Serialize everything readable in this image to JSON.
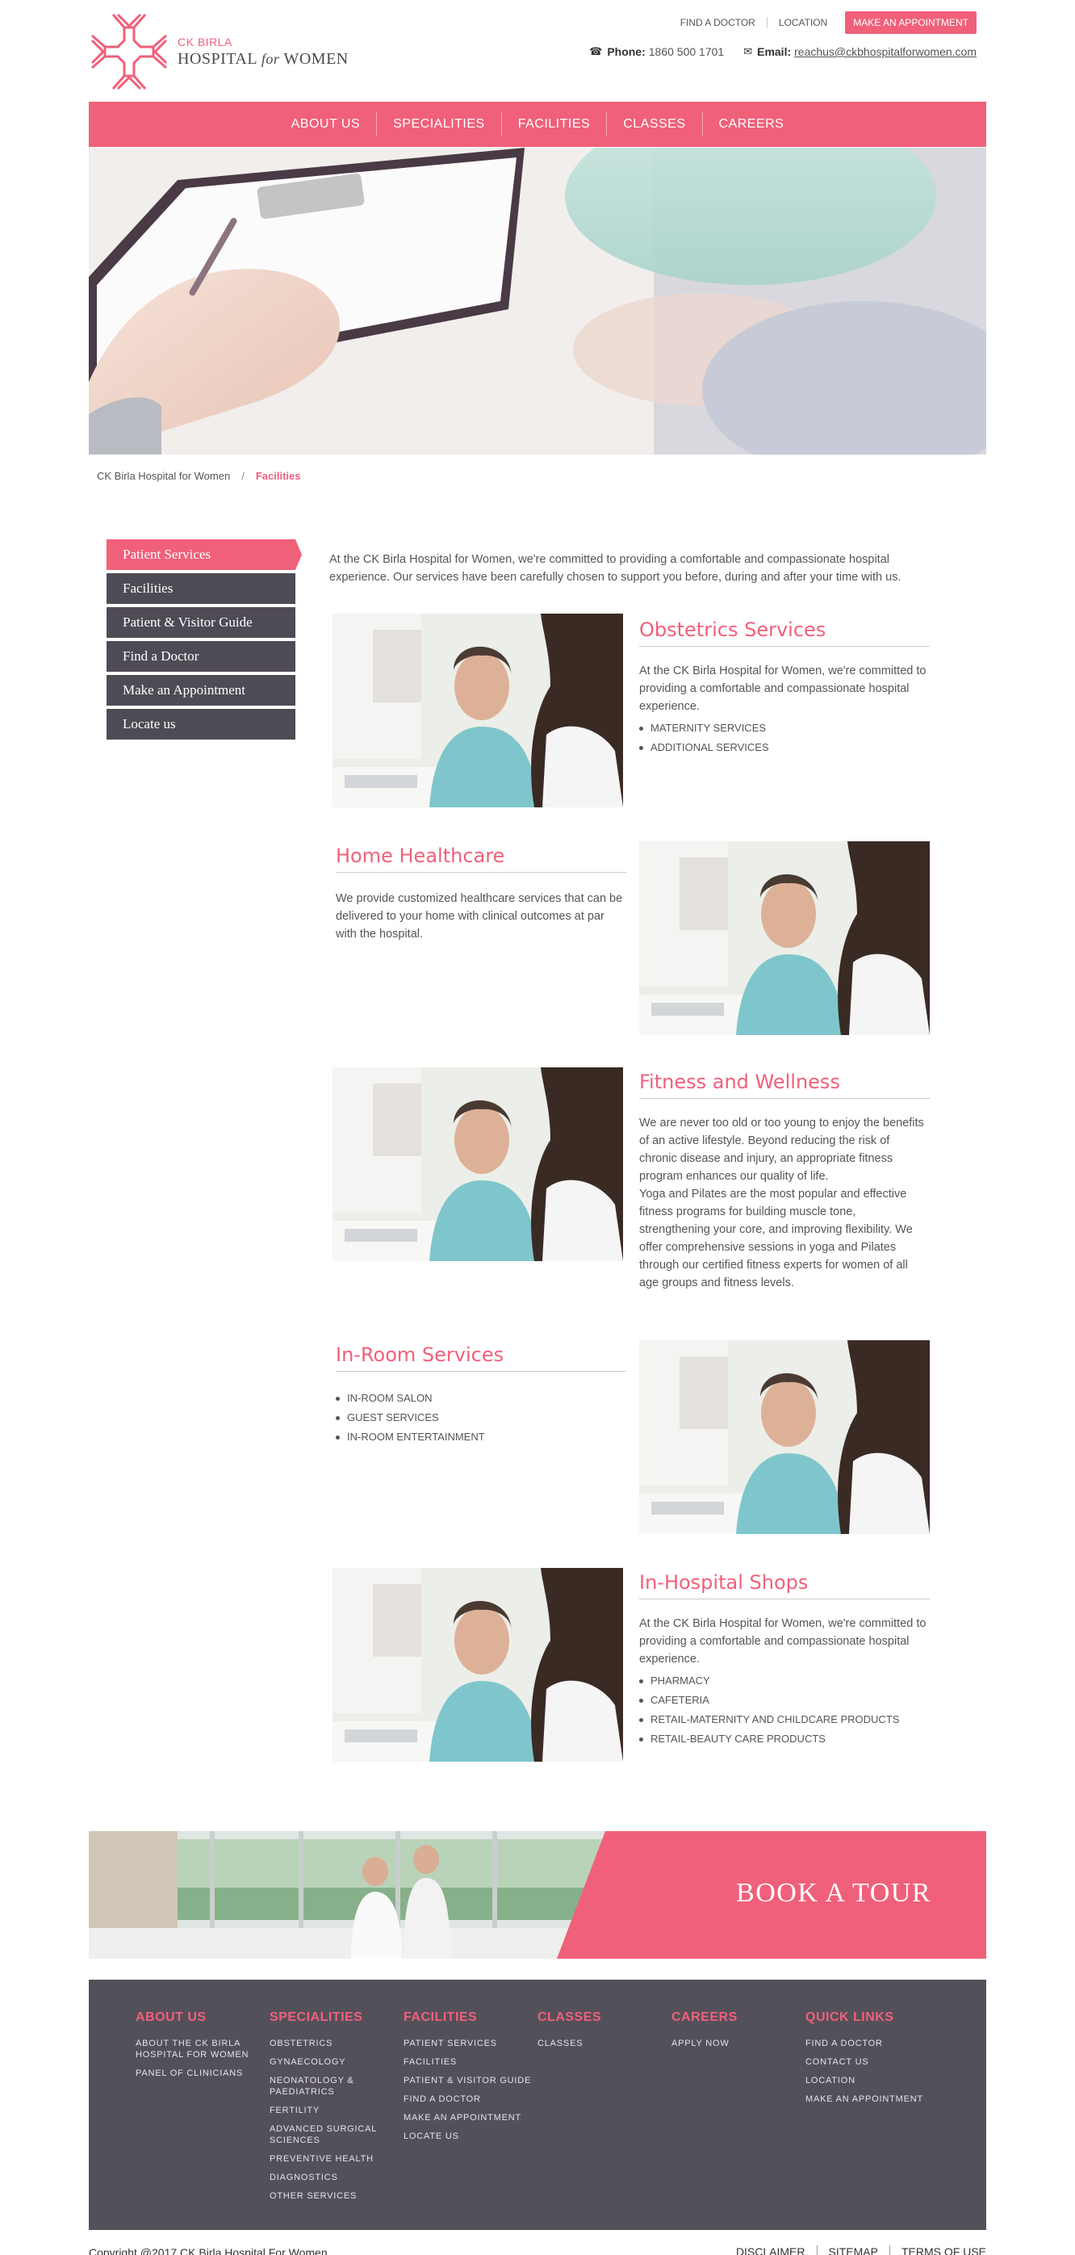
{
  "brand": {
    "top": "CK BIRLA",
    "name_pre": "HOSPITAL ",
    "name_italic": "for",
    "name_post": " WOMEN",
    "accent": "#f0607a",
    "dark": "#4f4b55"
  },
  "toplinks": {
    "find_doctor": "FIND A DOCTOR",
    "location": "LOCATION",
    "appointment": "MAKE AN APPOINTMENT"
  },
  "contact": {
    "phone_icon": "phone-icon",
    "phone_label": "Phone:",
    "phone_value": "1860 500 1701",
    "email_icon": "envelope-icon",
    "email_label": "Email:",
    "email_value": "reachus@ckbhospitalforwomen.com"
  },
  "nav": [
    "ABOUT US",
    "SPECIALITIES",
    "FACILITIES",
    "CLASSES",
    "CAREERS"
  ],
  "breadcrumb": {
    "home": "CK Birla Hospital for Women",
    "sep": "/",
    "current": "Facilities"
  },
  "sidebar": [
    "Patient Services",
    "Facilities",
    "Patient & Visitor Guide",
    "Find a Doctor",
    "Make an Appointment",
    "Locate us"
  ],
  "intro": "At the CK Birla Hospital for Women, we're committed to providing a comfortable and compassionate hospital experience. Our services have been carefully chosen to support you before, during and after your time with us.",
  "blocks": [
    {
      "title": "Obstetrics Services",
      "text": "At the CK Birla Hospital for Women, we're committed to providing a comfortable and compassionate hospital experience.",
      "items": [
        "MATERNITY SERVICES",
        "ADDITIONAL SERVICES"
      ]
    },
    {
      "title": "Home Healthcare",
      "text": "We provide customized healthcare services that can be delivered to your home with clinical outcomes at par with the hospital.",
      "items": []
    },
    {
      "title": "Fitness and Wellness",
      "text": "We are never too old or too young to enjoy the benefits of an active lifestyle. Beyond reducing the risk of chronic disease and injury, an appropriate fitness program enhances our quality of life.",
      "text2": "Yoga and Pilates are the most popular and effective fitness programs for building muscle tone, strengthening your core, and improving flexibility. We offer comprehensive sessions in yoga and Pilates through our certified fitness experts for women of all age groups and fitness levels.",
      "items": []
    },
    {
      "title": "In-Room Services",
      "text": "",
      "items": [
        "IN-ROOM SALON",
        "GUEST SERVICES",
        "IN-ROOM ENTERTAINMENT"
      ]
    },
    {
      "title": "In-Hospital Shops",
      "text": "At the CK Birla Hospital for Women, we're committed to providing a comfortable and compassionate hospital experience.",
      "items": [
        "PHARMACY",
        "CAFETERIA",
        "RETAIL-MATERNITY AND CHILDCARE PRODUCTS",
        "RETAIL-BEAUTY CARE PRODUCTS"
      ]
    }
  ],
  "tour": {
    "label": "BOOK A TOUR"
  },
  "footer": {
    "cols": [
      {
        "heading": "ABOUT US",
        "links": [
          "ABOUT THE CK BIRLA HOSPITAL FOR WOMEN",
          "PANEL OF CLINICIANS"
        ]
      },
      {
        "heading": "SPECIALITIES",
        "links": [
          "OBSTETRICS",
          "GYNAECOLOGY",
          "NEONATOLOGY & PAEDIATRICS",
          "FERTILITY",
          "ADVANCED SURGICAL SCIENCES",
          "PREVENTIVE HEALTH",
          "DIAGNOSTICS",
          "OTHER SERVICES"
        ]
      },
      {
        "heading": "FACILITIES",
        "links": [
          "PATIENT SERVICES",
          "FACILITIES",
          "PATIENT & VISITOR GUIDE",
          "FIND A DOCTOR",
          "MAKE AN APPOINTMENT",
          "LOCATE US"
        ]
      },
      {
        "heading": "CLASSES",
        "links": [
          "CLASSES"
        ]
      },
      {
        "heading": "CAREERS",
        "links": [
          "APPLY NOW"
        ]
      },
      {
        "heading": "QUICK LINKS",
        "links": [
          "FIND A DOCTOR",
          "CONTACT US",
          "LOCATION",
          "MAKE AN APPOINTMENT"
        ]
      }
    ],
    "copyright": "Copyright @2017 CK Birla Hospital For Women",
    "bottom_links": [
      "DISCLAIMER",
      "SITEMAP",
      "TERMS OF USE"
    ]
  }
}
